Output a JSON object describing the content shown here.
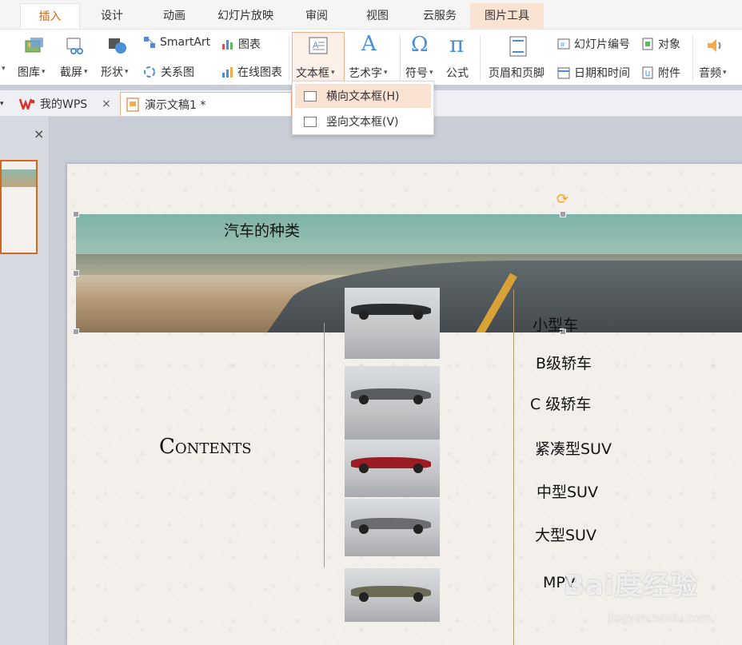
{
  "menu": {
    "tabs": [
      "插入",
      "设计",
      "动画",
      "幻灯片放映",
      "审阅",
      "视图",
      "云服务",
      "图片工具"
    ],
    "active": "插入"
  },
  "ribbon": {
    "picture": "图库",
    "screenshot": "截屏",
    "shapes": "形状",
    "smartart": "SmartArt",
    "chart": "图表",
    "relation": "关系图",
    "online_chart": "在线图表",
    "textbox": "文本框",
    "wordart": "艺术字",
    "symbol": "符号",
    "formula": "公式",
    "header_footer": "页眉和页脚",
    "slide_number": "幻灯片编号",
    "object": "对象",
    "date_time": "日期和时间",
    "attachment": "附件",
    "audio": "音频"
  },
  "dropdown": {
    "items": [
      "横向文本框(H)",
      "竖向文本框(V)"
    ]
  },
  "doc_tabs": {
    "mywps": "我的WPS",
    "doc": "演示文稿1 *",
    "close": "×"
  },
  "side_panel": {
    "close": "×"
  },
  "slide": {
    "title": "汽车的种类",
    "contents": "Contents",
    "items": [
      "小型车",
      "B级轿车",
      "C 级轿车",
      "紧凑型SUV",
      "中型SUV",
      "大型SUV",
      "MPV"
    ]
  },
  "watermark": {
    "main": "Bai度经验",
    "sub": "jingyan.baidu.com"
  },
  "colors": {
    "accent": "#d2691e",
    "highlight": "#fbe3d4",
    "slide_bg": "#f3f0ec",
    "rule": "#b19a6c"
  }
}
